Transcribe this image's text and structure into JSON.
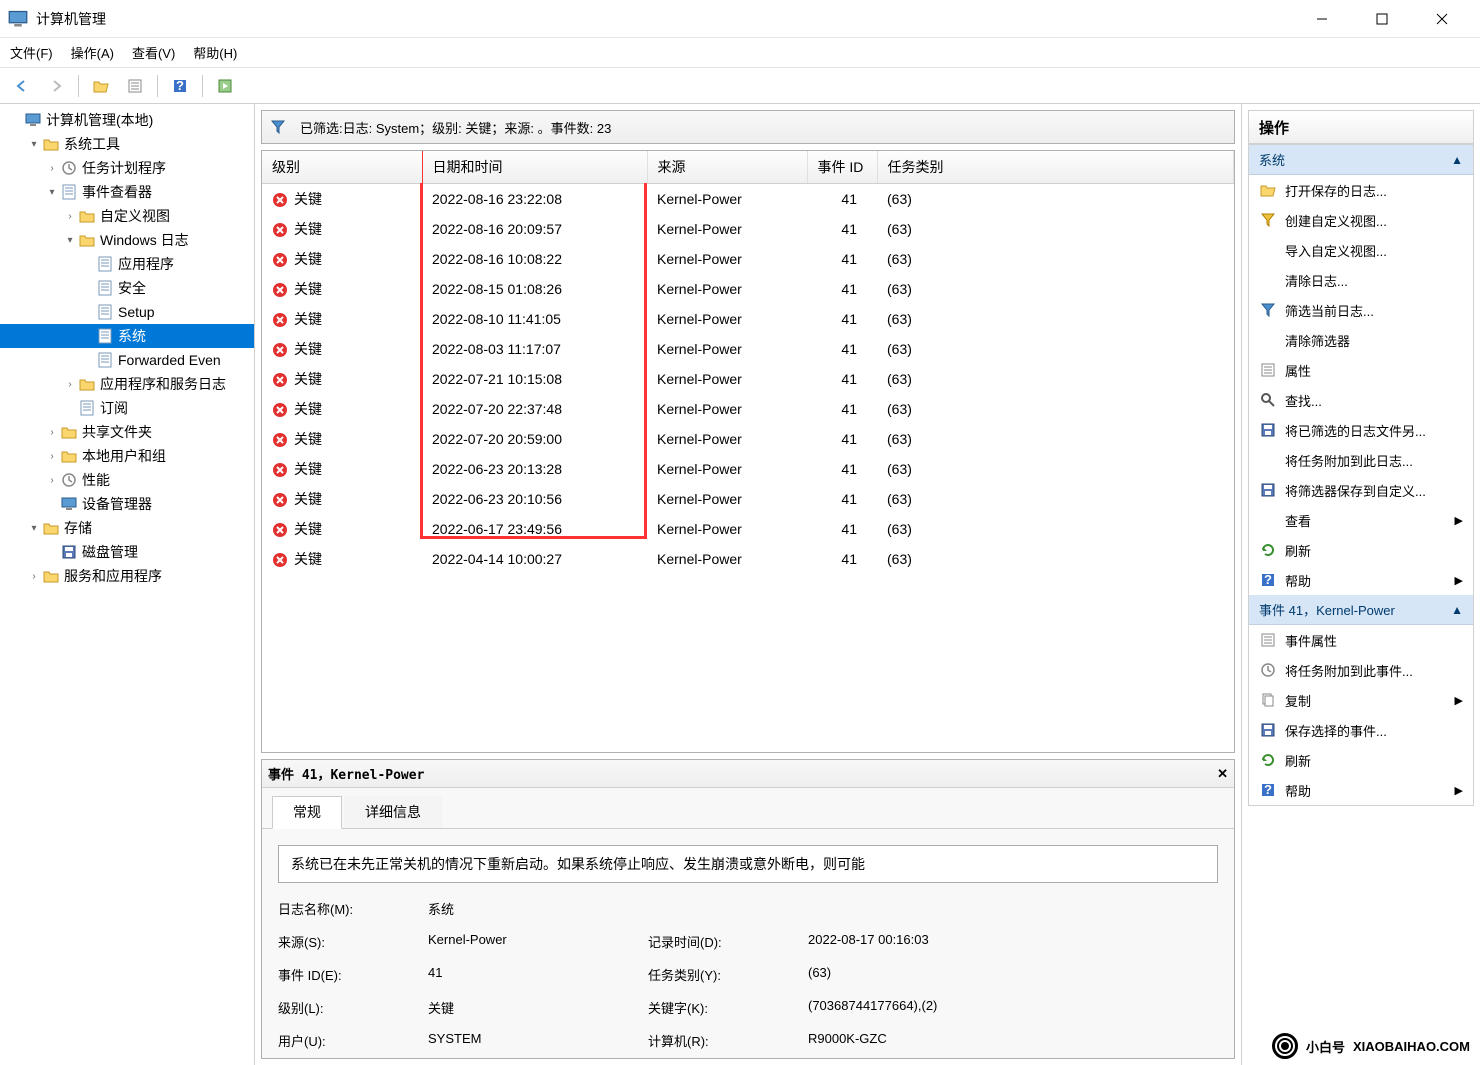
{
  "window": {
    "title": "计算机管理"
  },
  "menubar": [
    "文件(F)",
    "操作(A)",
    "查看(V)",
    "帮助(H)"
  ],
  "tree": [
    {
      "level": 0,
      "arrow": "",
      "icon": "computer",
      "label": "计算机管理(本地)"
    },
    {
      "level": 1,
      "arrow": "▾",
      "icon": "tools",
      "label": "系统工具"
    },
    {
      "level": 2,
      "arrow": ">",
      "icon": "scheduler",
      "label": "任务计划程序"
    },
    {
      "level": 2,
      "arrow": "▾",
      "icon": "eventviewer",
      "label": "事件查看器"
    },
    {
      "level": 3,
      "arrow": ">",
      "icon": "folder",
      "label": "自定义视图"
    },
    {
      "level": 3,
      "arrow": "▾",
      "icon": "folder",
      "label": "Windows 日志"
    },
    {
      "level": 4,
      "arrow": "",
      "icon": "log",
      "label": "应用程序"
    },
    {
      "level": 4,
      "arrow": "",
      "icon": "log",
      "label": "安全"
    },
    {
      "level": 4,
      "arrow": "",
      "icon": "log",
      "label": "Setup"
    },
    {
      "level": 4,
      "arrow": "",
      "icon": "log",
      "label": "系统",
      "selected": true
    },
    {
      "level": 4,
      "arrow": "",
      "icon": "log",
      "label": "Forwarded Even"
    },
    {
      "level": 3,
      "arrow": ">",
      "icon": "folder",
      "label": "应用程序和服务日志"
    },
    {
      "level": 3,
      "arrow": "",
      "icon": "subscribe",
      "label": "订阅"
    },
    {
      "level": 2,
      "arrow": ">",
      "icon": "shared",
      "label": "共享文件夹"
    },
    {
      "level": 2,
      "arrow": ">",
      "icon": "users",
      "label": "本地用户和组"
    },
    {
      "level": 2,
      "arrow": ">",
      "icon": "perf",
      "label": "性能"
    },
    {
      "level": 2,
      "arrow": "",
      "icon": "devmgr",
      "label": "设备管理器"
    },
    {
      "level": 1,
      "arrow": "▾",
      "icon": "storage",
      "label": "存储"
    },
    {
      "level": 2,
      "arrow": "",
      "icon": "disk",
      "label": "磁盘管理"
    },
    {
      "level": 1,
      "arrow": ">",
      "icon": "services",
      "label": "服务和应用程序"
    }
  ],
  "filterbar": "已筛选:日志: System；级别: 关键；来源: 。事件数: 23",
  "table": {
    "headers": [
      "级别",
      "日期和时间",
      "来源",
      "事件 ID",
      "任务类别"
    ],
    "rows": [
      {
        "level": "关键",
        "dt": "2022-08-16 23:22:08",
        "src": "Kernel-Power",
        "id": "41",
        "cat": "(63)"
      },
      {
        "level": "关键",
        "dt": "2022-08-16 20:09:57",
        "src": "Kernel-Power",
        "id": "41",
        "cat": "(63)"
      },
      {
        "level": "关键",
        "dt": "2022-08-16 10:08:22",
        "src": "Kernel-Power",
        "id": "41",
        "cat": "(63)"
      },
      {
        "level": "关键",
        "dt": "2022-08-15 01:08:26",
        "src": "Kernel-Power",
        "id": "41",
        "cat": "(63)"
      },
      {
        "level": "关键",
        "dt": "2022-08-10 11:41:05",
        "src": "Kernel-Power",
        "id": "41",
        "cat": "(63)"
      },
      {
        "level": "关键",
        "dt": "2022-08-03 11:17:07",
        "src": "Kernel-Power",
        "id": "41",
        "cat": "(63)"
      },
      {
        "level": "关键",
        "dt": "2022-07-21 10:15:08",
        "src": "Kernel-Power",
        "id": "41",
        "cat": "(63)"
      },
      {
        "level": "关键",
        "dt": "2022-07-20 22:37:48",
        "src": "Kernel-Power",
        "id": "41",
        "cat": "(63)"
      },
      {
        "level": "关键",
        "dt": "2022-07-20 20:59:00",
        "src": "Kernel-Power",
        "id": "41",
        "cat": "(63)"
      },
      {
        "level": "关键",
        "dt": "2022-06-23 20:13:28",
        "src": "Kernel-Power",
        "id": "41",
        "cat": "(63)"
      },
      {
        "level": "关键",
        "dt": "2022-06-23 20:10:56",
        "src": "Kernel-Power",
        "id": "41",
        "cat": "(63)"
      },
      {
        "level": "关键",
        "dt": "2022-06-17 23:49:56",
        "src": "Kernel-Power",
        "id": "41",
        "cat": "(63)"
      },
      {
        "level": "关键",
        "dt": "2022-04-14 10:00:27",
        "src": "Kernel-Power",
        "id": "41",
        "cat": "(63)"
      }
    ]
  },
  "detail": {
    "header": "事件 41，Kernel-Power",
    "tabs": [
      "常规",
      "详细信息"
    ],
    "description": "系统已在未先正常关机的情况下重新启动。如果系统停止响应、发生崩溃或意外断电，则可能",
    "props": [
      {
        "k1": "日志名称(M):",
        "v1": "系统",
        "k2": "",
        "v2": ""
      },
      {
        "k1": "来源(S):",
        "v1": "Kernel-Power",
        "k2": "记录时间(D):",
        "v2": "2022-08-17 00:16:03"
      },
      {
        "k1": "事件 ID(E):",
        "v1": "41",
        "k2": "任务类别(Y):",
        "v2": "(63)"
      },
      {
        "k1": "级别(L):",
        "v1": "关键",
        "k2": "关键字(K):",
        "v2": "(70368744177664),(2)"
      },
      {
        "k1": "用户(U):",
        "v1": "SYSTEM",
        "k2": "计算机(R):",
        "v2": "R9000K-GZC"
      }
    ]
  },
  "actions": {
    "title": "操作",
    "section1": {
      "header": "系统",
      "items": [
        {
          "icon": "open",
          "label": "打开保存的日志...",
          "arrow": false
        },
        {
          "icon": "funnel-y",
          "label": "创建自定义视图...",
          "arrow": false
        },
        {
          "icon": "blank",
          "label": "导入自定义视图...",
          "arrow": false
        },
        {
          "icon": "blank",
          "label": "清除日志...",
          "arrow": false
        },
        {
          "icon": "funnel-b",
          "label": "筛选当前日志...",
          "arrow": false
        },
        {
          "icon": "blank",
          "label": "清除筛选器",
          "arrow": false
        },
        {
          "icon": "props",
          "label": "属性",
          "arrow": false
        },
        {
          "icon": "find",
          "label": "查找...",
          "arrow": false
        },
        {
          "icon": "save",
          "label": "将已筛选的日志文件另...",
          "arrow": false
        },
        {
          "icon": "blank",
          "label": "将任务附加到此日志...",
          "arrow": false
        },
        {
          "icon": "save2",
          "label": "将筛选器保存到自定义...",
          "arrow": false
        },
        {
          "icon": "blank",
          "label": "查看",
          "arrow": true
        },
        {
          "icon": "refresh",
          "label": "刷新",
          "arrow": false
        },
        {
          "icon": "help",
          "label": "帮助",
          "arrow": true
        }
      ]
    },
    "section2": {
      "header": "事件 41，Kernel-Power",
      "items": [
        {
          "icon": "props",
          "label": "事件属性",
          "arrow": false
        },
        {
          "icon": "attach",
          "label": "将任务附加到此事件...",
          "arrow": false
        },
        {
          "icon": "copy",
          "label": "复制",
          "arrow": true
        },
        {
          "icon": "save",
          "label": "保存选择的事件...",
          "arrow": false
        },
        {
          "icon": "refresh",
          "label": "刷新",
          "arrow": false
        },
        {
          "icon": "help",
          "label": "帮助",
          "arrow": true
        }
      ]
    }
  },
  "watermark": {
    "name": "小白号",
    "url": "XIAOBAIHAO.COM"
  }
}
